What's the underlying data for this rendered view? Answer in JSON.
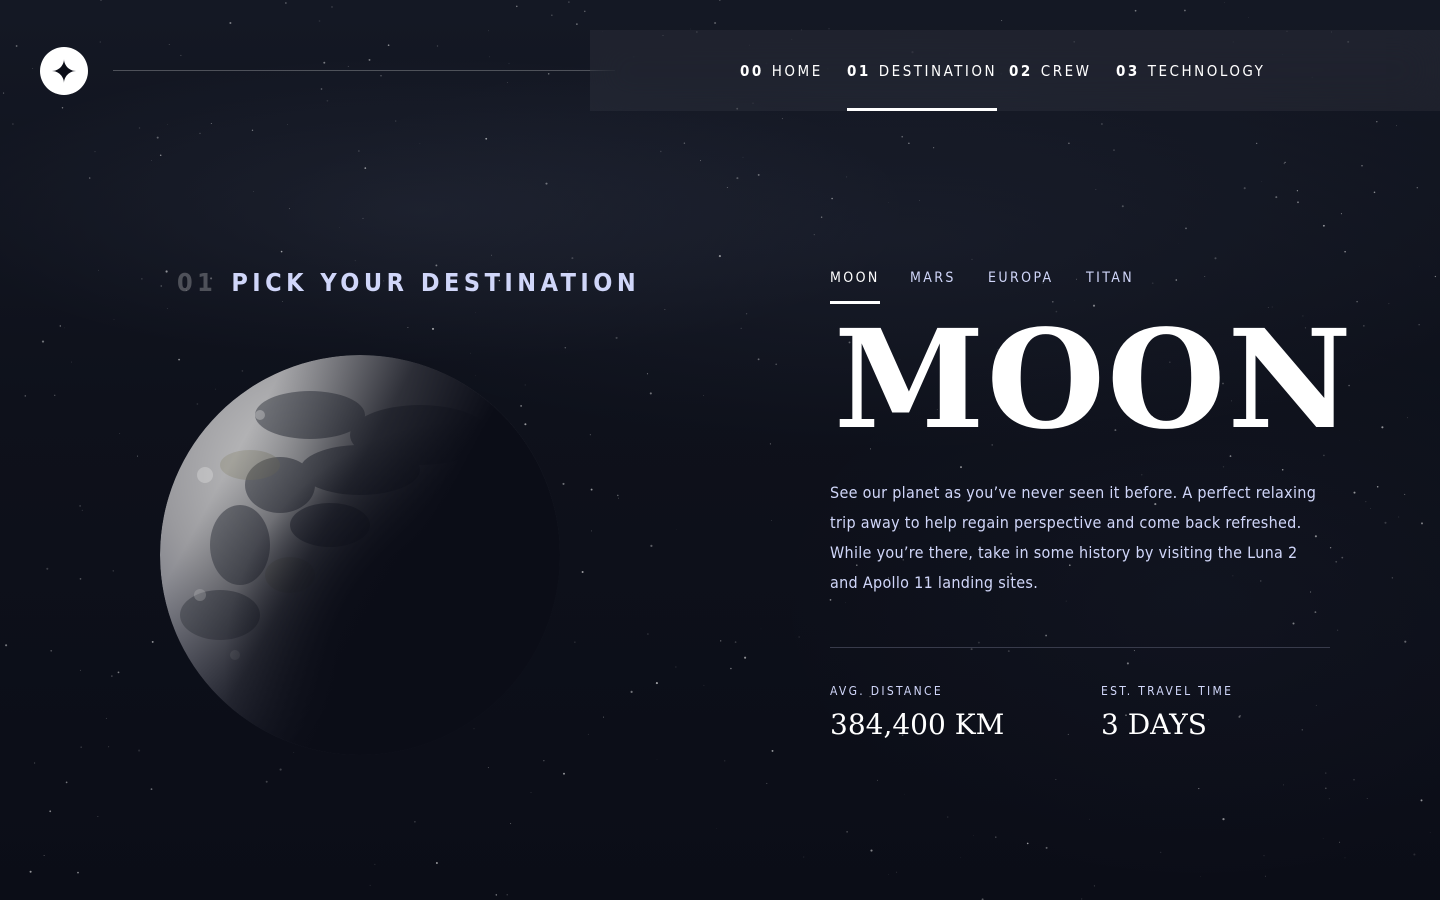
{
  "header": {
    "logo_icon": "star-logo-icon",
    "nav": [
      {
        "num": "00",
        "label": "HOME",
        "active": false
      },
      {
        "num": "01",
        "label": "DESTINATION",
        "active": true
      },
      {
        "num": "02",
        "label": "CREW",
        "active": false
      },
      {
        "num": "03",
        "label": "TECHNOLOGY",
        "active": false
      }
    ]
  },
  "page": {
    "section_num": "01",
    "section_title": "PICK YOUR DESTINATION"
  },
  "destinations": {
    "tabs": [
      "MOON",
      "MARS",
      "EUROPA",
      "TITAN"
    ],
    "active_tab": "MOON",
    "name": "MOON",
    "description": "See our planet as you’ve never seen it before. A perfect relaxing trip away to help regain perspective and come back refreshed. While you’re there, take in some history by visiting the Luna 2 and Apollo 11 landing sites.",
    "stats": {
      "distance_label": "AVG. DISTANCE",
      "distance_value": "384,400 KM",
      "travel_label": "EST. TRAVEL TIME",
      "travel_value": "3 DAYS"
    }
  },
  "colors": {
    "background": "#0b0d17",
    "accent_text": "#d0d6f9",
    "white": "#ffffff"
  }
}
